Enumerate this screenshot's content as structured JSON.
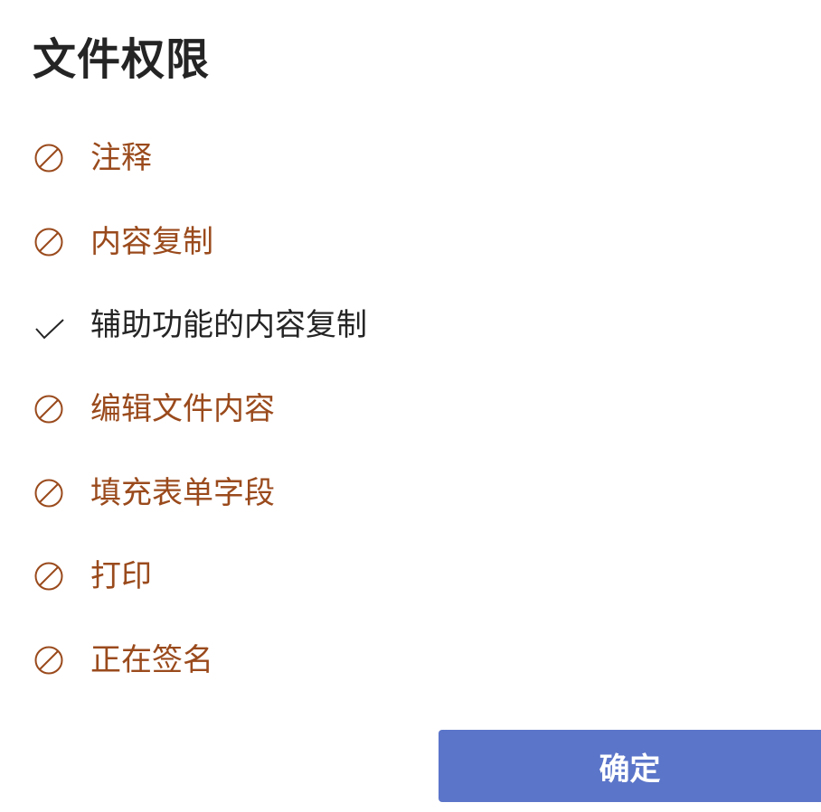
{
  "dialog": {
    "title": "文件权限",
    "permissions": [
      {
        "label": "注释",
        "status": "denied",
        "icon": "prohibited-icon"
      },
      {
        "label": "内容复制",
        "status": "denied",
        "icon": "prohibited-icon"
      },
      {
        "label": "辅助功能的内容复制",
        "status": "allowed",
        "icon": "checkmark-icon"
      },
      {
        "label": "编辑文件内容",
        "status": "denied",
        "icon": "prohibited-icon"
      },
      {
        "label": "填充表单字段",
        "status": "denied",
        "icon": "prohibited-icon"
      },
      {
        "label": "打印",
        "status": "denied",
        "icon": "prohibited-icon"
      },
      {
        "label": "正在签名",
        "status": "denied",
        "icon": "prohibited-icon"
      }
    ],
    "ok_button_label": "确定"
  },
  "colors": {
    "denied": "#9a4a1c",
    "allowed": "#242424",
    "button": "#5b75c9"
  }
}
